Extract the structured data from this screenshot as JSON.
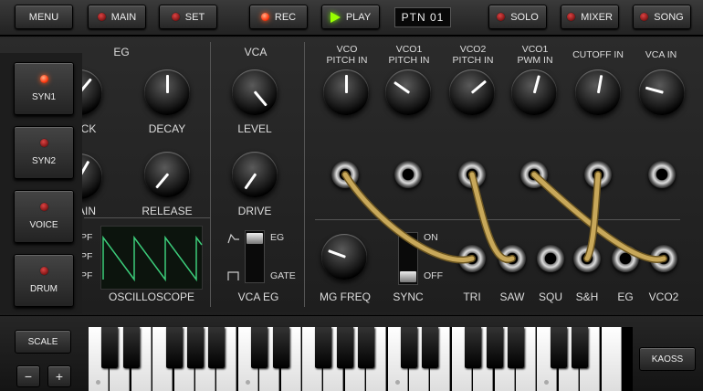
{
  "toolbar": {
    "menu": "MENU",
    "main": "MAIN",
    "set": "SET",
    "rec": "REC",
    "play": "PLAY",
    "pattern": "PTN 01",
    "solo": "SOLO",
    "mixer": "MIXER",
    "song": "SONG"
  },
  "side_tabs": [
    "SYN1",
    "SYN2",
    "VOICE",
    "DRUM"
  ],
  "sections": {
    "eg": "EG",
    "vca": "VCA"
  },
  "knob_labels": {
    "attack": "CK",
    "decay": "DECAY",
    "sustain": "AIN",
    "release": "RELEASE",
    "level": "LEVEL",
    "drive": "DRIVE",
    "mg_freq": "MG FREQ"
  },
  "patch_inputs": [
    [
      "VCO",
      "PITCH IN"
    ],
    [
      "VCO1",
      "PITCH IN"
    ],
    [
      "VCO2",
      "PITCH IN"
    ],
    [
      "VCO1",
      "PWM IN"
    ],
    [
      "CUTOFF IN",
      ""
    ],
    [
      "VCA IN",
      ""
    ]
  ],
  "patch_outputs": [
    "TRI",
    "SAW",
    "SQU",
    "S&H",
    "EG",
    "VCO2"
  ],
  "oscilloscope": "OSCILLOSCOPE",
  "osc_left_labels": [
    "PF",
    "PF",
    "PF"
  ],
  "vca_eg": {
    "label": "VCA EG",
    "top": "EG",
    "bottom": "GATE"
  },
  "sync": {
    "label": "SYNC",
    "on": "ON",
    "off": "OFF"
  },
  "keyboard": {
    "scale": "SCALE",
    "minus": "−",
    "plus": "+",
    "kaoss": "KAOSS"
  },
  "colors": {
    "cable": "#c8a85a",
    "led_on": "#ff4a1a",
    "play": "#99ff00"
  }
}
